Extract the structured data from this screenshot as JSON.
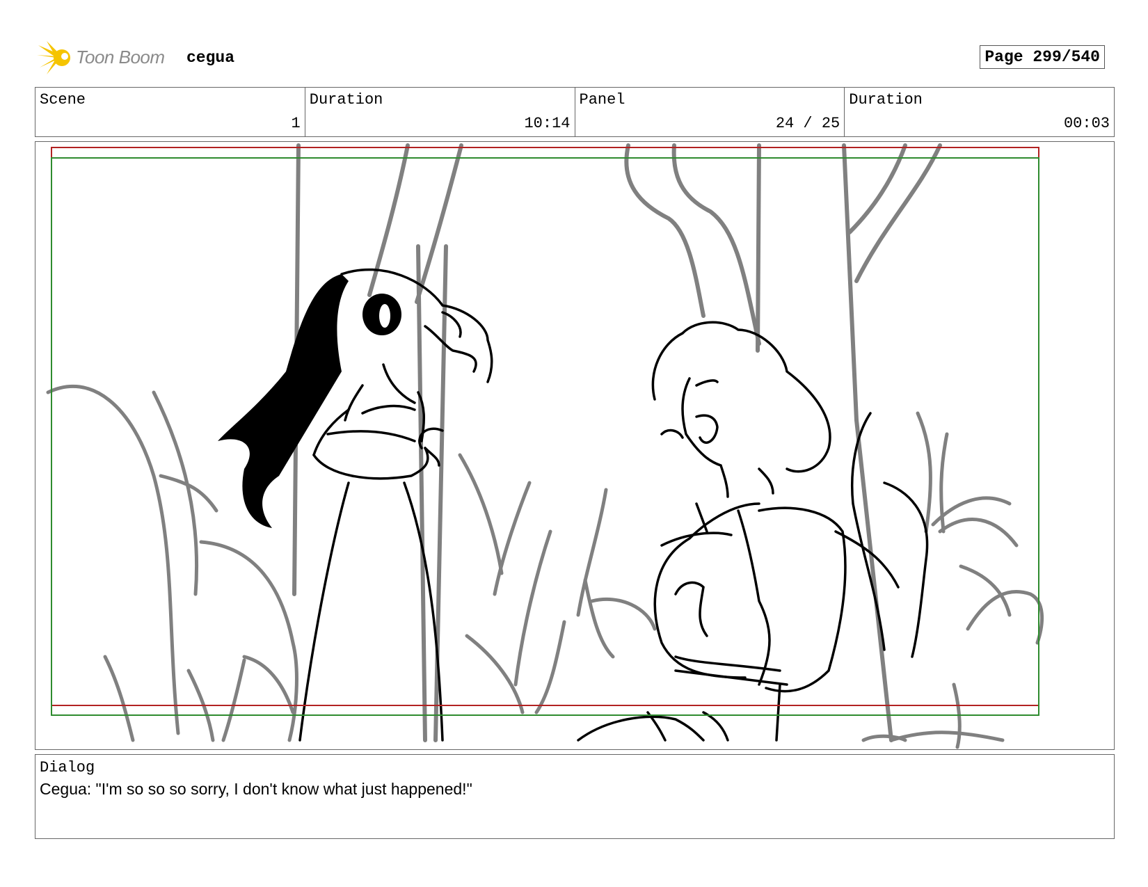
{
  "header": {
    "logo_text": "Toon Boom",
    "project": "cegua",
    "page": "Page 299/540"
  },
  "info": [
    {
      "label": "Scene",
      "value": "1"
    },
    {
      "label": "Duration",
      "value": "10:14"
    },
    {
      "label": "Panel",
      "value": "24 / 25"
    },
    {
      "label": "Duration",
      "value": "00:03"
    }
  ],
  "dialog": {
    "label": "Dialog",
    "text": "Cegua: \"I'm so so so sorry, I don't know what just happened!\""
  },
  "colors": {
    "safe_frame_red": "#b22222",
    "safe_frame_green": "#2e8b2e",
    "logo_yellow": "#f5c400"
  }
}
